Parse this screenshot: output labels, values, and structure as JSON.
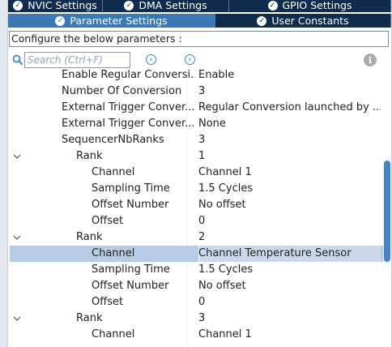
{
  "tabs_top": [
    {
      "label": "NVIC Settings"
    },
    {
      "label": "DMA Settings"
    },
    {
      "label": "GPIO Settings"
    }
  ],
  "tabs_second": [
    {
      "label": "Parameter Settings",
      "active": true
    },
    {
      "label": "User Constants",
      "active": false
    }
  ],
  "description": "Configure the below parameters :",
  "search": {
    "placeholder": "Search (Ctrl+F)",
    "value": ""
  },
  "icons": {
    "search": "search-icon",
    "prev": "previous-icon",
    "next": "next-icon",
    "info": "info-icon",
    "tab": "check-circle-icon",
    "expand": "chevron-down-icon"
  },
  "colors": {
    "tab_bg": "#0e2c4d",
    "tab_active": "#3a79b8",
    "selection": "#b6cbe4",
    "scroll_thumb": "#3f86cf"
  },
  "params": [
    {
      "label": "Enable Regular Conversi...",
      "value": "Enable",
      "level": 1,
      "expandable": false
    },
    {
      "label": "Number Of Conversion",
      "value": "3",
      "level": 1,
      "expandable": false
    },
    {
      "label": "External Trigger Conver...",
      "value": "Regular Conversion launched by ...",
      "level": 1,
      "expandable": false
    },
    {
      "label": "External Trigger Conver...",
      "value": "None",
      "level": 1,
      "expandable": false
    },
    {
      "label": "SequencerNbRanks",
      "value": "3",
      "level": 1,
      "expandable": false
    },
    {
      "label": "Rank",
      "value": "1",
      "level": 2,
      "expandable": true
    },
    {
      "label": "Channel",
      "value": "Channel 1",
      "level": 3,
      "expandable": false
    },
    {
      "label": "Sampling Time",
      "value": "1.5 Cycles",
      "level": 3,
      "expandable": false
    },
    {
      "label": "Offset Number",
      "value": "No offset",
      "level": 3,
      "expandable": false
    },
    {
      "label": "Offset",
      "value": "0",
      "level": 3,
      "expandable": false
    },
    {
      "label": "Rank",
      "value": "2",
      "level": 2,
      "expandable": true
    },
    {
      "label": "Channel",
      "value": "Channel Temperature Sensor",
      "level": 3,
      "expandable": false,
      "selected": true
    },
    {
      "label": "Sampling Time",
      "value": "1.5 Cycles",
      "level": 3,
      "expandable": false
    },
    {
      "label": "Offset Number",
      "value": "No offset",
      "level": 3,
      "expandable": false
    },
    {
      "label": "Offset",
      "value": "0",
      "level": 3,
      "expandable": false
    },
    {
      "label": "Rank",
      "value": "3",
      "level": 2,
      "expandable": true
    },
    {
      "label": "Channel",
      "value": "Channel 1",
      "level": 3,
      "expandable": false
    }
  ]
}
